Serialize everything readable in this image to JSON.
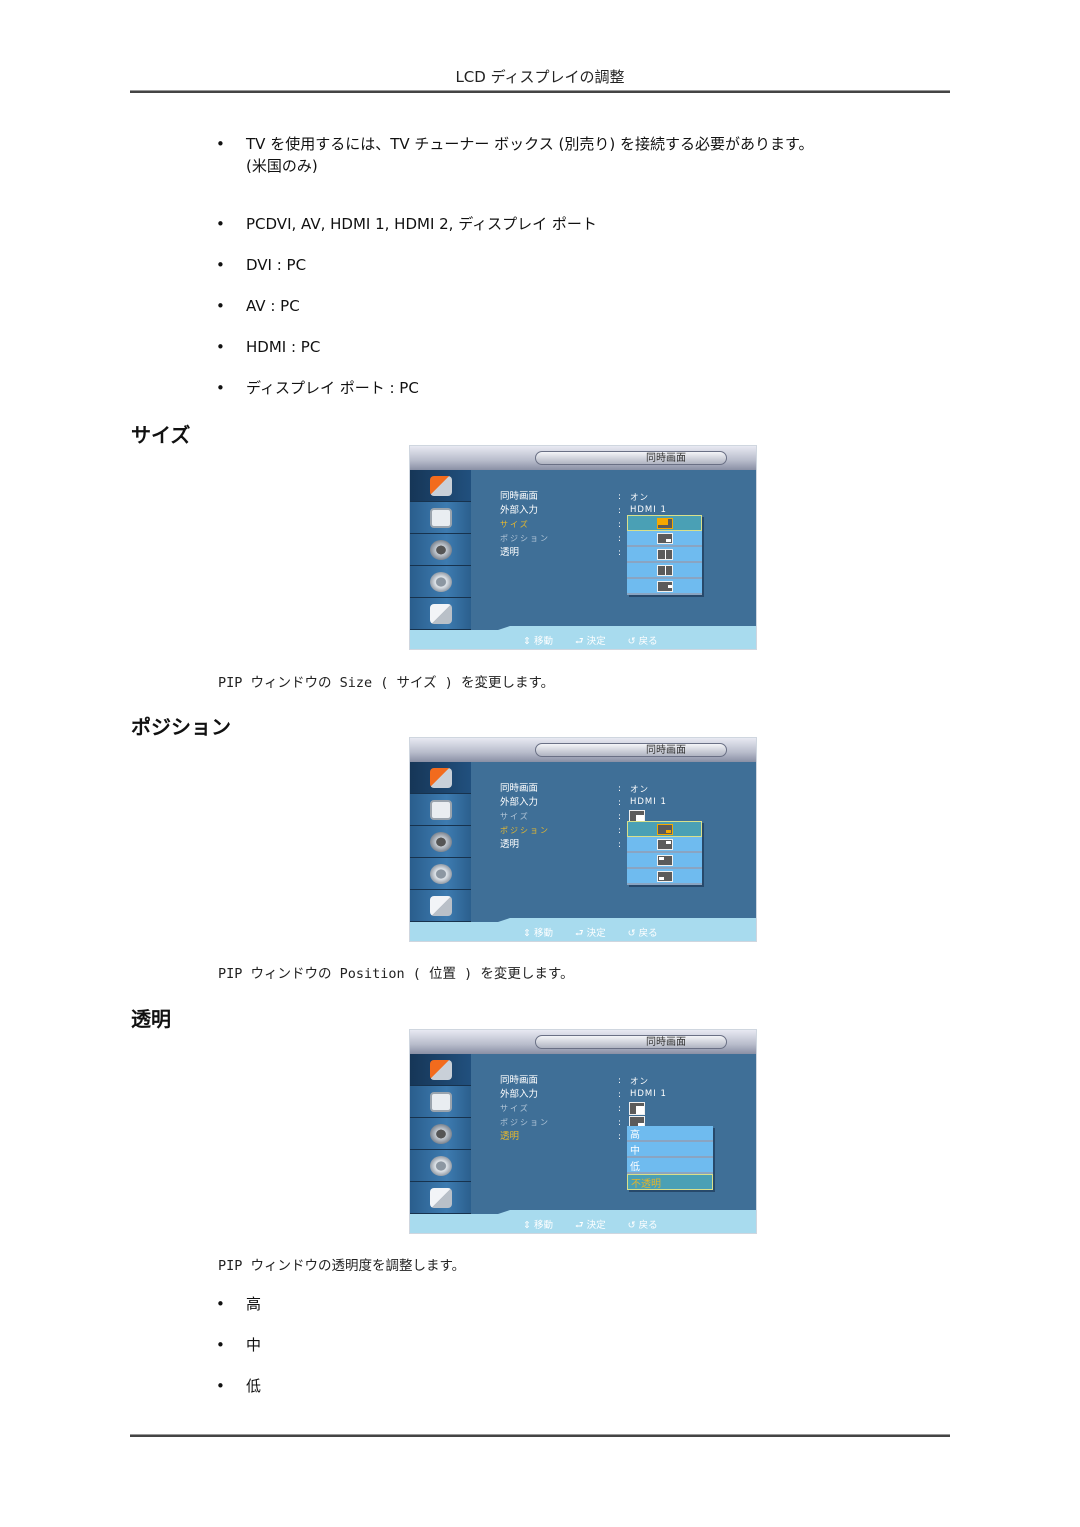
{
  "header": {
    "title": "LCD ディスプレイの調整"
  },
  "intro_bullets": [
    {
      "text": "TV を使用するには、TV チューナー ボックス (別売り) を接続する必要があります。",
      "continuation": "(米国のみ)"
    },
    {
      "text": "PCDVI, AV, HDMI 1, HDMI 2, ディスプレイ ポート"
    },
    {
      "text": "DVI : PC"
    },
    {
      "text": "AV : PC"
    },
    {
      "text": "HDMI : PC"
    },
    {
      "text": "ディスプレイ ポート : PC"
    }
  ],
  "bullet_char": "•",
  "osd_common": {
    "title": "同時画面",
    "rows": [
      "同時画面",
      "外部入力",
      "サイズ",
      "ポジション",
      "透明"
    ],
    "colon": ":",
    "values": {
      "pip": "オン",
      "source": "HDMI 1"
    },
    "hints": [
      {
        "icon": "updown-arrow-icon",
        "glyph": "⇕",
        "label": "移動"
      },
      {
        "icon": "enter-icon",
        "glyph": "⮐",
        "label": "決定"
      },
      {
        "icon": "return-icon",
        "glyph": "↺",
        "label": "戻る"
      }
    ],
    "sidebar": [
      "input",
      "picture",
      "sound",
      "setup",
      "multi-control"
    ]
  },
  "sections": [
    {
      "title": "サイズ",
      "selected_row": "サイズ",
      "dropdown_options": [
        "size-1",
        "size-2",
        "size-3",
        "size-4",
        "size-5"
      ],
      "dropdown_selected_index": 0,
      "caption": "PIP ウィンドウの Size ( サイズ ) を変更します。"
    },
    {
      "title": "ポジション",
      "selected_row": "ポジション",
      "dropdown_options": [
        "position-bottom-right",
        "position-top-right",
        "position-top-left",
        "position-bottom-left"
      ],
      "dropdown_selected_index": 0,
      "caption": "PIP ウィンドウの Position ( 位置 ) を変更します。"
    },
    {
      "title": "透明",
      "selected_row": "透明",
      "dropdown_options": [
        "高",
        "中",
        "低",
        "不透明"
      ],
      "dropdown_selected_index": 3,
      "caption": "PIP ウィンドウの透明度を調整します。"
    }
  ],
  "transparency_bullets": [
    "高",
    "中",
    "低"
  ]
}
